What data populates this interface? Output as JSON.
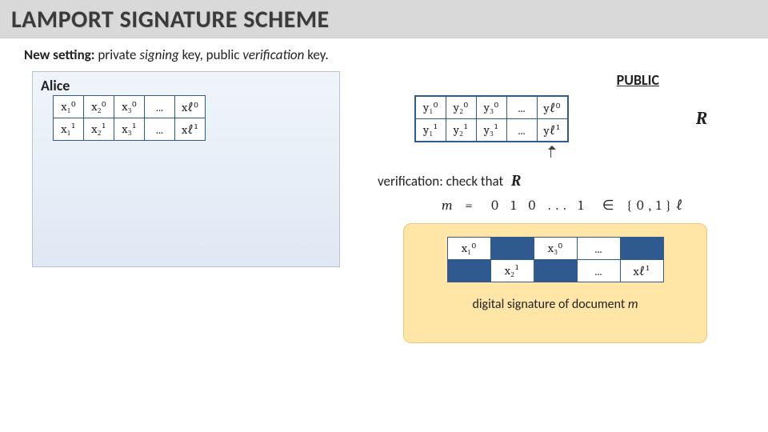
{
  "title": "LAMPORT SIGNATURE SCHEME",
  "setting_bold": "New setting:",
  "setting_plain1": " private ",
  "setting_ital1": "signing",
  "setting_plain2": " key, public ",
  "setting_ital2": "verification",
  "setting_plain3": " key.",
  "alice_label": "Alice",
  "public_label": "PUBLIC",
  "R_symbol": "R",
  "x_table": {
    "row0": [
      "x₁⁰",
      "x₂⁰",
      "x₃⁰",
      "...",
      "xℓ⁰"
    ],
    "row1": [
      "x₁¹",
      "x₂¹",
      "x₃¹",
      "...",
      "xℓ¹"
    ]
  },
  "y_table": {
    "row0": [
      "y₁⁰",
      "y₂⁰",
      "y₃⁰",
      "...",
      "yℓ⁰"
    ],
    "row1": [
      "y₁¹",
      "y₂¹",
      "y₃¹",
      "...",
      "yℓ¹"
    ]
  },
  "verification_text": "verification: check that",
  "m_eq_prefix": "m = ",
  "m_bits": "0  1  0   ...   1",
  "m_domain": " ∈ {0,1}ℓ",
  "sig_table": {
    "row0": [
      "x₁⁰",
      "",
      "x₃⁰",
      "...",
      ""
    ],
    "row1": [
      "",
      "x₂¹",
      "",
      "...",
      "xℓ¹"
    ]
  },
  "sig_caption_plain": "digital signature of document ",
  "sig_caption_ital": "m"
}
